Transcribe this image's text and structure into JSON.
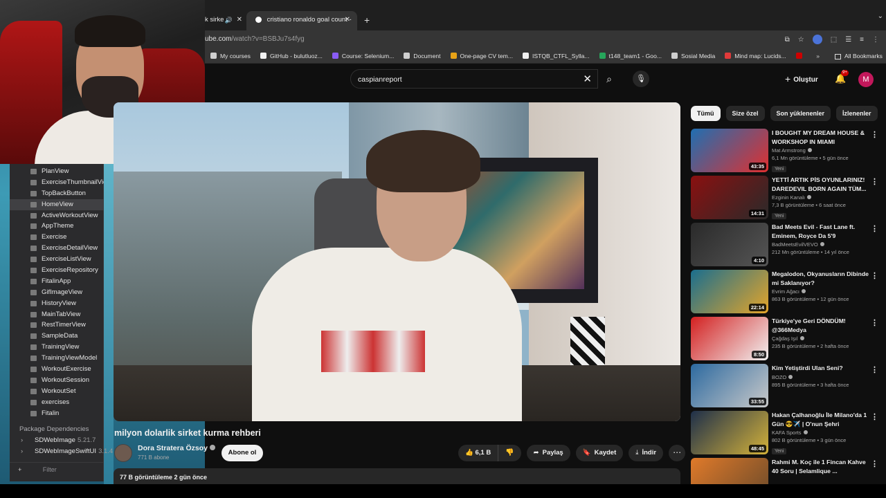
{
  "ide": {
    "items": [
      "PlanView",
      "ExerciseThumbnailView",
      "TopBackButton",
      "HomeView",
      "ActiveWorkoutView",
      "AppTheme",
      "Exercise",
      "ExerciseDetailView",
      "ExerciseListView",
      "ExerciseRepository",
      "FitalinApp",
      "GifImageView",
      "HistoryView",
      "MainTabView",
      "RestTimerView",
      "SampleData",
      "TrainingView",
      "TrainingViewModel",
      "WorkoutExercise",
      "WorkoutSession",
      "WorkoutSet",
      "exercises",
      "Fitalin"
    ],
    "selected_index": 3,
    "section": "Package Dependencies",
    "packages": [
      {
        "name": "SDWebImage",
        "version": "5.21.7"
      },
      {
        "name": "SDWebImageSwiftUI",
        "version": "3.1.4"
      }
    ],
    "filter_placeholder": "Filter",
    "add": "+"
  },
  "browser": {
    "tab1_label": "k sirke",
    "tab2_label": "cristiano ronaldo goal count -",
    "url_host": "ube.com",
    "url_path": "/watch?v=BSBJu7s4fyg",
    "bookmarks": [
      "My courses",
      "GitHub - bulutluoz...",
      "Course: Selenium...",
      "Document",
      "One-page CV tem...",
      "ISTQB_CTFL_Sylla...",
      "t148_team1 - Goo...",
      "Sosial Media",
      "Mind map: Lucids..."
    ],
    "all_bookmarks": "All Bookmarks",
    "bookmarks_more": "»",
    "bookmark_colors": [
      "#cfcfcf",
      "#f1f1f1",
      "#8a5cf6",
      "#cfcfcf",
      "#e8a317",
      "#f1f1f1",
      "#26a65b",
      "#cfcfcf",
      "#e03a3a"
    ]
  },
  "youtube": {
    "search_query": "caspianreport",
    "create_label": "Oluştur",
    "notif_count": "9+",
    "user_initial": "M",
    "video_title": "milyon dolarlik sirket kurma rehberi",
    "channel_name": "Dora Stratera Özsoy",
    "subscribers": "771 B abone",
    "subscribe_label": "Abone ol",
    "likes": "6,1 B",
    "share_label": "Paylaş",
    "save_label": "Kaydet",
    "download_label": "İndir",
    "description_meta": "77 B görüntüleme  2 gün önce",
    "chips": [
      "Tümü",
      "Size özel",
      "Son yüklenenler",
      "İzlenenler"
    ],
    "accent": "#cc0000"
  },
  "recommendations": [
    {
      "title": "I BOUGHT MY DREAM HOUSE & WORKSHOP IN MIAMI",
      "channel": "Mat Armstrong",
      "meta": "6,1 Mn görüntüleme • 5 gün önce",
      "badge": "Yeni",
      "duration": "43:35",
      "colors": [
        "#1f6fb2",
        "#e03030"
      ]
    },
    {
      "title": "YETTİ ARTIK PİS OYUNLARINIZ! DAREDEVIL BORN AGAIN TÜM...",
      "channel": "Ezginin Kanalı",
      "meta": "7,3 B görüntüleme • 6 saat önce",
      "badge": "Yeni",
      "duration": "14:31",
      "colors": [
        "#8a1010",
        "#2a2a2a"
      ]
    },
    {
      "title": "Bad Meets Evil - Fast Lane ft. Eminem, Royce Da 5'9",
      "channel": "BadMeetsEvilVEVO",
      "meta": "212 Mn görüntüleme • 14 yıl önce",
      "badge": "",
      "duration": "4:10",
      "colors": [
        "#2a2a2a",
        "#555"
      ]
    },
    {
      "title": "Megalodon, Okyanusların Dibinde mi Saklanıyor?",
      "channel": "Evrim Ağacı",
      "meta": "863 B görüntüleme • 12 gün önce",
      "badge": "",
      "duration": "22:14",
      "colors": [
        "#1a6e8e",
        "#e4a52a"
      ]
    },
    {
      "title": "Türkiye'ye Geri DÖNDÜM! @366Medya",
      "channel": "Çağdaş Işıl",
      "meta": "235 B görüntüleme • 2 hafta önce",
      "badge": "",
      "duration": "8:50",
      "colors": [
        "#d32020",
        "#f1f1f1"
      ]
    },
    {
      "title": "Kim Yetiştirdi Ulan Seni?",
      "channel": "BOZO",
      "meta": "895 B görüntüleme • 3 hafta önce",
      "badge": "",
      "duration": "33:55",
      "colors": [
        "#2d6aa0",
        "#c9c9c9"
      ]
    },
    {
      "title": "Hakan Çalhanoğlu İle Milano'da 1 Gün 😎✈️ | O'nun Şehri",
      "channel": "KAFA Sports",
      "meta": "802 B görüntüleme • 3 gün önce",
      "badge": "Yeni",
      "duration": "48:45",
      "colors": [
        "#1e2f4a",
        "#d4b23a"
      ]
    },
    {
      "title": "Rahmi M. Koç ile 1 Fincan Kahve 40 Soru | Selamlique ...",
      "channel": "",
      "meta": "",
      "badge": "",
      "duration": "",
      "colors": [
        "#e07a2a",
        "#6b4a2a"
      ]
    }
  ]
}
